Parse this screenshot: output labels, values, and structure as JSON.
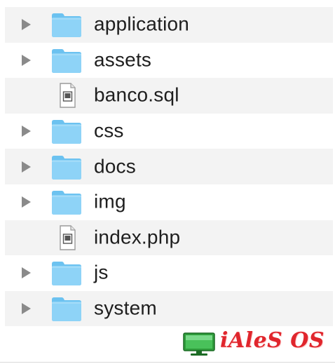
{
  "items": [
    {
      "name": "application",
      "kind": "folder",
      "striped": true
    },
    {
      "name": "assets",
      "kind": "folder",
      "striped": false
    },
    {
      "name": "banco.sql",
      "kind": "file",
      "striped": true
    },
    {
      "name": "css",
      "kind": "folder",
      "striped": false
    },
    {
      "name": "docs",
      "kind": "folder",
      "striped": true
    },
    {
      "name": "img",
      "kind": "folder",
      "striped": false
    },
    {
      "name": "index.php",
      "kind": "file",
      "striped": true
    },
    {
      "name": "js",
      "kind": "folder",
      "striped": false
    },
    {
      "name": "system",
      "kind": "folder",
      "striped": true
    }
  ],
  "icons": {
    "folder": "folder-icon",
    "file": "document-icon",
    "disclosure": "disclosure-triangle-icon"
  },
  "watermark": {
    "text": "iAleS OS",
    "icon": "monitor-icon"
  },
  "colors": {
    "folder_fill": "#8ed3f7",
    "folder_tab": "#6cc2f0",
    "stripe": "#f3f3f3",
    "disclosure": "#8a8a8a",
    "brand_red": "#e0262d",
    "monitor_green": "#2f9d3c"
  }
}
